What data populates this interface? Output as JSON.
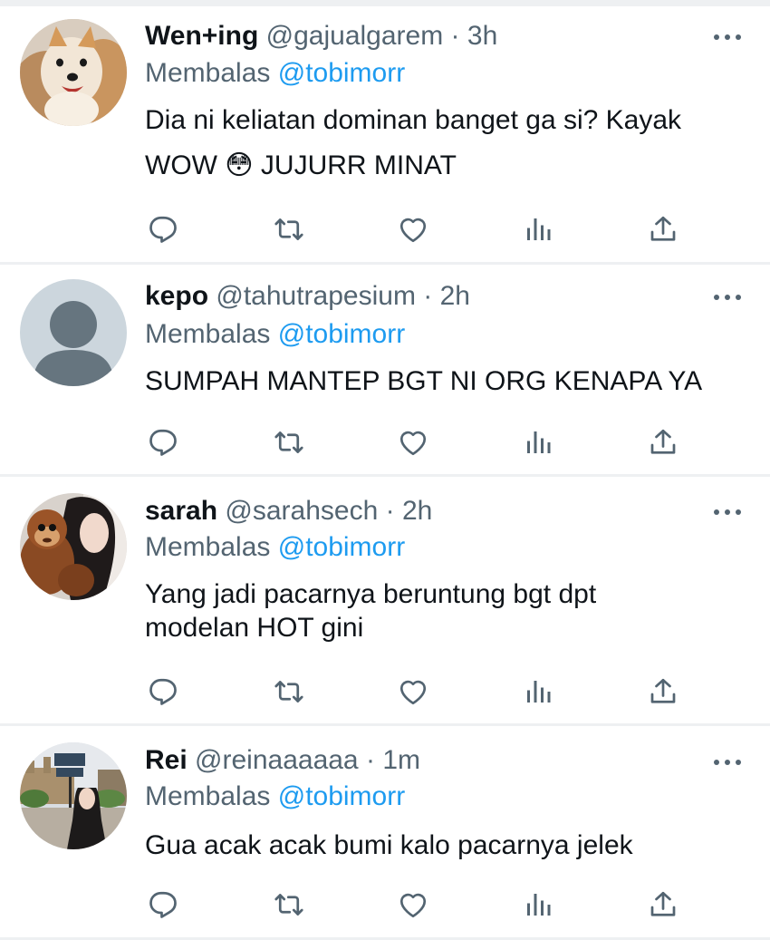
{
  "colors": {
    "text": "#0f1419",
    "muted": "#536471",
    "link": "#1d9bf0",
    "divider": "#eef0f2"
  },
  "icons": [
    "reply-icon",
    "retweet-icon",
    "like-icon",
    "views-icon",
    "share-icon",
    "more-icon"
  ],
  "tweets": [
    {
      "name": "Wen+ing",
      "handle": "@gajualgarem",
      "separator": "·",
      "time": "3h",
      "replying_prefix": "Membalas",
      "replying_to": "@tobimorr",
      "lines": [
        "Dia ni keliatan dominan banget ga si? Kayak",
        "WOW 😳 JUJURR MINAT"
      ],
      "avatar": "dog-photo"
    },
    {
      "name": "kepo",
      "handle": "@tahutrapesium",
      "separator": "·",
      "time": "2h",
      "replying_prefix": "Membalas",
      "replying_to": "@tobimorr",
      "lines": [
        "SUMPAH MANTEP BGT NI ORG KENAPA YA"
      ],
      "avatar": "default-avatar"
    },
    {
      "name": "sarah",
      "handle": "@sarahsech",
      "separator": "·",
      "time": "2h",
      "replying_prefix": "Membalas",
      "replying_to": "@tobimorr",
      "lines": [
        "Yang jadi pacarnya beruntung bgt dpt",
        "modelan HOT gini"
      ],
      "avatar": "girl-with-plush-photo"
    },
    {
      "name": "Rei",
      "handle": "@reinaaaaaa",
      "separator": "·",
      "time": "1m",
      "replying_prefix": "Membalas",
      "replying_to": "@tobimorr",
      "lines": [
        "Gua acak acak bumi kalo pacarnya jelek"
      ],
      "avatar": "city-street-photo"
    }
  ]
}
